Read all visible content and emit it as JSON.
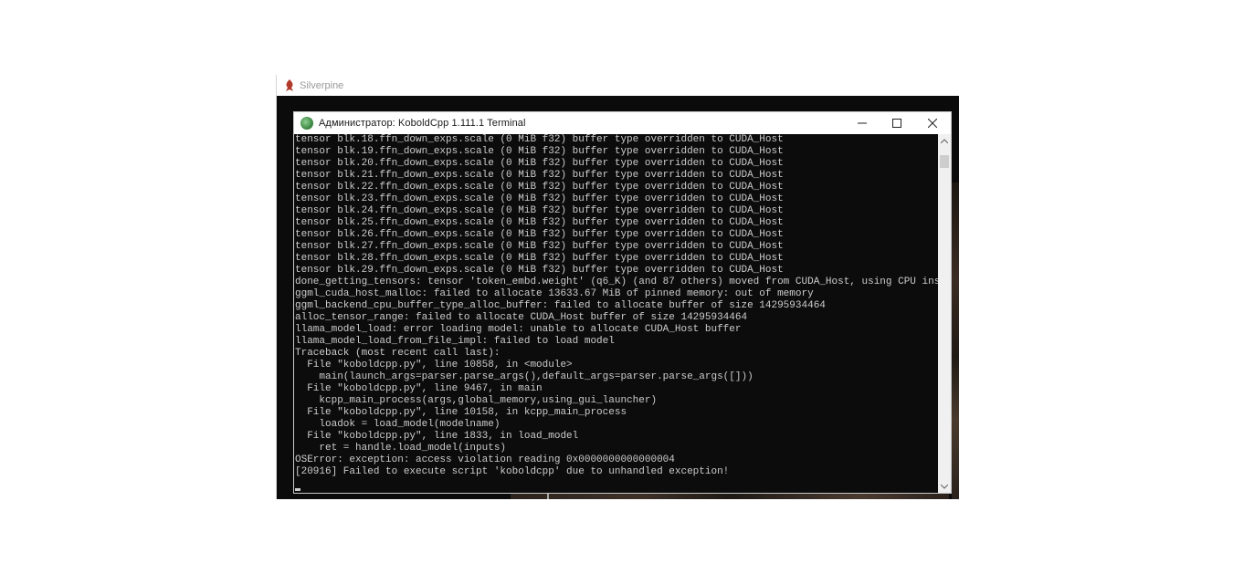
{
  "background_app": {
    "title": "Silverpine",
    "icon": "silverpine-app-icon"
  },
  "terminal": {
    "title": "Администратор:  KoboldCpp 1.111.1 Terminal",
    "icon": "koboldcpp-icon",
    "controls": {
      "minimize": "—",
      "maximize": "☐",
      "close": "✕"
    },
    "lines": [
      "tensor blk.18.ffn_down_exps.scale (0 MiB f32) buffer type overridden to CUDA_Host",
      "tensor blk.19.ffn_down_exps.scale (0 MiB f32) buffer type overridden to CUDA_Host",
      "tensor blk.20.ffn_down_exps.scale (0 MiB f32) buffer type overridden to CUDA_Host",
      "tensor blk.21.ffn_down_exps.scale (0 MiB f32) buffer type overridden to CUDA_Host",
      "tensor blk.22.ffn_down_exps.scale (0 MiB f32) buffer type overridden to CUDA_Host",
      "tensor blk.23.ffn_down_exps.scale (0 MiB f32) buffer type overridden to CUDA_Host",
      "tensor blk.24.ffn_down_exps.scale (0 MiB f32) buffer type overridden to CUDA_Host",
      "tensor blk.25.ffn_down_exps.scale (0 MiB f32) buffer type overridden to CUDA_Host",
      "tensor blk.26.ffn_down_exps.scale (0 MiB f32) buffer type overridden to CUDA_Host",
      "tensor blk.27.ffn_down_exps.scale (0 MiB f32) buffer type overridden to CUDA_Host",
      "tensor blk.28.ffn_down_exps.scale (0 MiB f32) buffer type overridden to CUDA_Host",
      "tensor blk.29.ffn_down_exps.scale (0 MiB f32) buffer type overridden to CUDA_Host",
      "done_getting_tensors: tensor 'token_embd.weight' (q6_K) (and 87 others) moved from CUDA_Host, using CPU instead",
      "ggml_cuda_host_malloc: failed to allocate 13633.67 MiB of pinned memory: out of memory",
      "ggml_backend_cpu_buffer_type_alloc_buffer: failed to allocate buffer of size 14295934464",
      "alloc_tensor_range: failed to allocate CUDA_Host buffer of size 14295934464",
      "llama_model_load: error loading model: unable to allocate CUDA_Host buffer",
      "llama_model_load_from_file_impl: failed to load model",
      "Traceback (most recent call last):",
      "  File \"koboldcpp.py\", line 10858, in <module>",
      "    main(launch_args=parser.parse_args(),default_args=parser.parse_args([]))",
      "  File \"koboldcpp.py\", line 9467, in main",
      "    kcpp_main_process(args,global_memory,using_gui_launcher)",
      "  File \"koboldcpp.py\", line 10158, in kcpp_main_process",
      "    loadok = load_model(modelname)",
      "  File \"koboldcpp.py\", line 1833, in load_model",
      "    ret = handle.load_model(inputs)",
      "OSError: exception: access violation reading 0x0000000000000004",
      "[20916] Failed to execute script 'koboldcpp' due to unhandled exception!"
    ],
    "scrollbar": {
      "up_arrow": "⌃",
      "down_arrow": "⌄"
    }
  }
}
